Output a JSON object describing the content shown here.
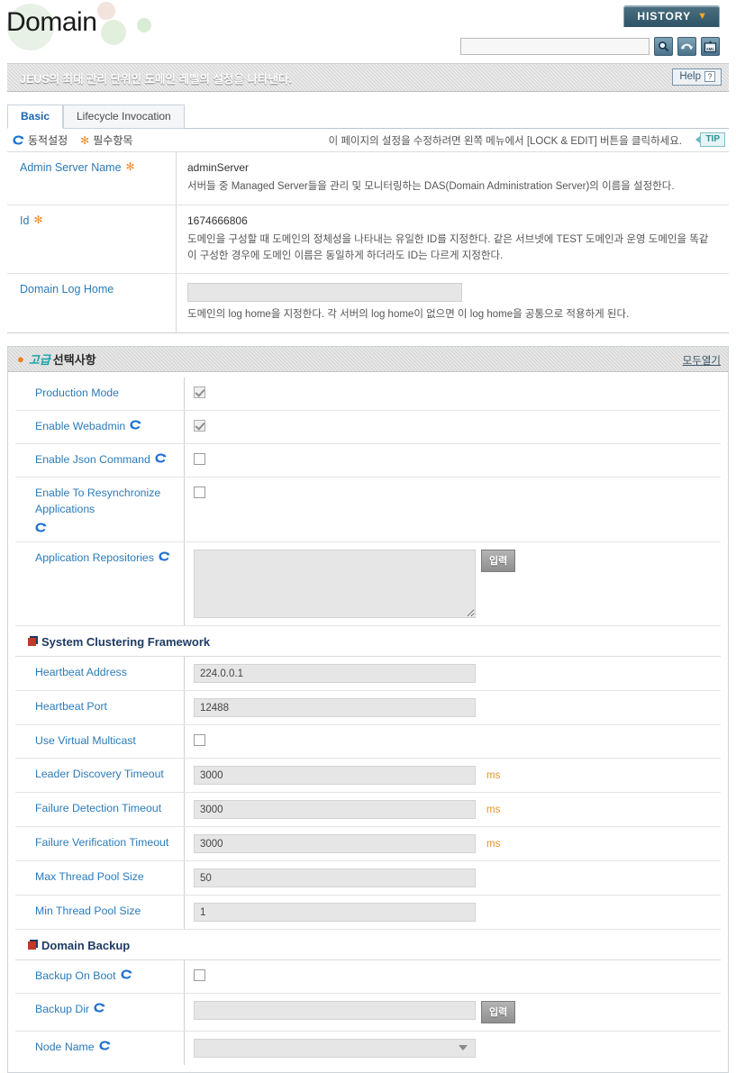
{
  "header": {
    "logo_text": "Domain",
    "history_label": "HISTORY",
    "history_chevron": "▼",
    "search_value": "",
    "search_placeholder": "",
    "buttons": [
      {
        "name": "search-icon",
        "title": "Search"
      },
      {
        "name": "refresh-icon",
        "title": "Refresh"
      },
      {
        "name": "xml-export-icon",
        "title": "XML"
      }
    ]
  },
  "description_bar": {
    "text": "JEUS의 최대 관리 단위인 도메인 레벨의 설정을 나타낸다.",
    "help_label": "Help",
    "help_mark": "?"
  },
  "tabs": [
    {
      "label": "Basic",
      "active": true
    },
    {
      "label": "Lifecycle Invocation",
      "active": false
    }
  ],
  "legend": {
    "dynamic_label": "동적설정",
    "required_label": "필수항목",
    "required_mark": "✻",
    "note": "이 페이지의 설정을 수정하려면 왼쪽 메뉴에서 [LOCK & EDIT] 버튼을 클릭하세요.",
    "tip_label": "TIP"
  },
  "basic": {
    "rows": [
      {
        "label": "Admin Server Name",
        "required": true,
        "value": "adminServer",
        "description": "서버들 중 Managed Server들을 관리 및 모니터링하는 DAS(Domain Administration Server)의 이름을 설정한다."
      },
      {
        "label": "Id",
        "required": true,
        "value": "1674666806",
        "description": "도메인을 구성할 때 도메인의 정체성을 나타내는 유일한 ID를 지정한다. 같은 서브넷에 TEST 도메인과 운영 도메인을 똑같이 구성한 경우에 도메인 이름은 동일하게 하더라도 ID는 다르게 지정한다."
      },
      {
        "label": "Domain Log Home",
        "required": false,
        "value": "",
        "description": "도메인의 log home을 지정한다. 각 서버의 log home이 없으면 이 log home을 공통으로 적용하게 된다."
      }
    ]
  },
  "advanced": {
    "title_emphasis": "고급",
    "title_rest": "선택사항",
    "open_all_label": "모두열기",
    "fields": [
      {
        "label": "Production Mode",
        "dynamic": false,
        "type": "checkbox",
        "checked": true,
        "disabled": true,
        "value": "",
        "unit": ""
      },
      {
        "label": "Enable Webadmin",
        "dynamic": true,
        "type": "checkbox",
        "checked": true,
        "disabled": true,
        "value": "",
        "unit": ""
      },
      {
        "label": "Enable Json Command",
        "dynamic": true,
        "type": "checkbox",
        "checked": false,
        "disabled": false,
        "value": "",
        "unit": ""
      },
      {
        "label": "Enable To Resynchronize Applications",
        "dynamic": true,
        "type": "checkbox",
        "checked": false,
        "disabled": false,
        "value": "",
        "unit": ""
      },
      {
        "label": "Application Repositories",
        "dynamic": true,
        "type": "textarea",
        "value": "",
        "button_label": "입력",
        "unit": ""
      }
    ],
    "clustering": {
      "title": "System Clustering Framework",
      "fields": [
        {
          "label": "Heartbeat Address",
          "dynamic": false,
          "type": "text",
          "value": "224.0.0.1",
          "unit": ""
        },
        {
          "label": "Heartbeat Port",
          "dynamic": false,
          "type": "text",
          "value": "12488",
          "unit": ""
        },
        {
          "label": "Use Virtual Multicast",
          "dynamic": false,
          "type": "checkbox",
          "checked": false,
          "disabled": false,
          "value": "",
          "unit": ""
        },
        {
          "label": "Leader Discovery Timeout",
          "dynamic": false,
          "type": "text",
          "value": "3000",
          "unit": "ms"
        },
        {
          "label": "Failure Detection Timeout",
          "dynamic": false,
          "type": "text",
          "value": "3000",
          "unit": "ms"
        },
        {
          "label": "Failure Verification Timeout",
          "dynamic": false,
          "type": "text",
          "value": "3000",
          "unit": "ms"
        },
        {
          "label": "Max Thread Pool Size",
          "dynamic": false,
          "type": "text",
          "value": "50",
          "unit": ""
        },
        {
          "label": "Min Thread Pool Size",
          "dynamic": false,
          "type": "text",
          "value": "1",
          "unit": ""
        }
      ]
    },
    "backup": {
      "title": "Domain Backup",
      "fields": [
        {
          "label": "Backup On Boot",
          "dynamic": true,
          "type": "checkbox",
          "checked": false,
          "disabled": false,
          "value": "",
          "unit": ""
        },
        {
          "label": "Backup Dir",
          "dynamic": true,
          "type": "text_button",
          "value": "",
          "button_label": "입력",
          "unit": ""
        },
        {
          "label": "Node Name",
          "dynamic": true,
          "type": "select",
          "value": "",
          "unit": ""
        }
      ]
    }
  },
  "colors": {
    "label_blue": "#2b7bb9",
    "accent_orange": "#f08a24",
    "unit_orange": "#e0952a",
    "teal": "#17a2a8",
    "subhead_navy": "#1f3b63"
  }
}
